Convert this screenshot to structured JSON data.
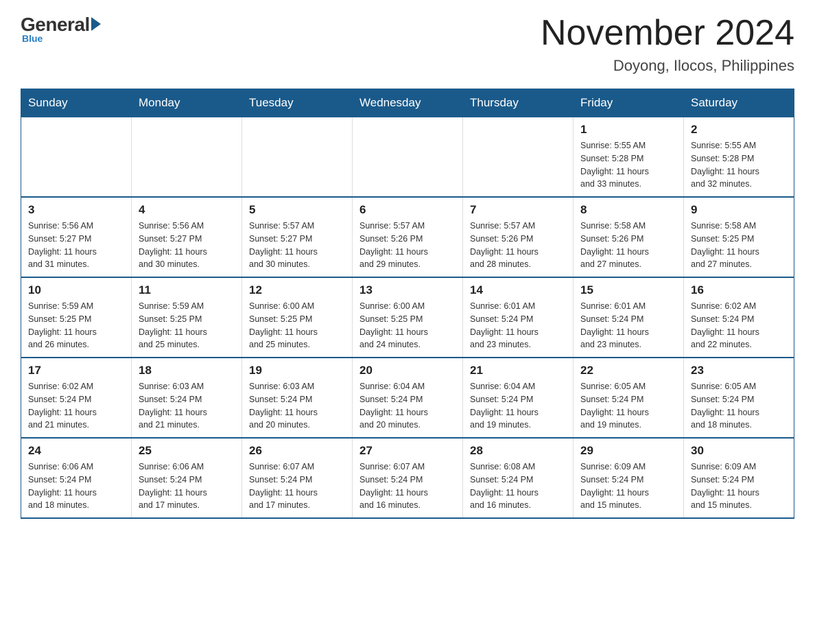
{
  "logo": {
    "general": "General",
    "blue": "Blue"
  },
  "header": {
    "title": "November 2024",
    "location": "Doyong, Ilocos, Philippines"
  },
  "weekdays": [
    "Sunday",
    "Monday",
    "Tuesday",
    "Wednesday",
    "Thursday",
    "Friday",
    "Saturday"
  ],
  "weeks": [
    [
      {
        "day": "",
        "info": ""
      },
      {
        "day": "",
        "info": ""
      },
      {
        "day": "",
        "info": ""
      },
      {
        "day": "",
        "info": ""
      },
      {
        "day": "",
        "info": ""
      },
      {
        "day": "1",
        "info": "Sunrise: 5:55 AM\nSunset: 5:28 PM\nDaylight: 11 hours\nand 33 minutes."
      },
      {
        "day": "2",
        "info": "Sunrise: 5:55 AM\nSunset: 5:28 PM\nDaylight: 11 hours\nand 32 minutes."
      }
    ],
    [
      {
        "day": "3",
        "info": "Sunrise: 5:56 AM\nSunset: 5:27 PM\nDaylight: 11 hours\nand 31 minutes."
      },
      {
        "day": "4",
        "info": "Sunrise: 5:56 AM\nSunset: 5:27 PM\nDaylight: 11 hours\nand 30 minutes."
      },
      {
        "day": "5",
        "info": "Sunrise: 5:57 AM\nSunset: 5:27 PM\nDaylight: 11 hours\nand 30 minutes."
      },
      {
        "day": "6",
        "info": "Sunrise: 5:57 AM\nSunset: 5:26 PM\nDaylight: 11 hours\nand 29 minutes."
      },
      {
        "day": "7",
        "info": "Sunrise: 5:57 AM\nSunset: 5:26 PM\nDaylight: 11 hours\nand 28 minutes."
      },
      {
        "day": "8",
        "info": "Sunrise: 5:58 AM\nSunset: 5:26 PM\nDaylight: 11 hours\nand 27 minutes."
      },
      {
        "day": "9",
        "info": "Sunrise: 5:58 AM\nSunset: 5:25 PM\nDaylight: 11 hours\nand 27 minutes."
      }
    ],
    [
      {
        "day": "10",
        "info": "Sunrise: 5:59 AM\nSunset: 5:25 PM\nDaylight: 11 hours\nand 26 minutes."
      },
      {
        "day": "11",
        "info": "Sunrise: 5:59 AM\nSunset: 5:25 PM\nDaylight: 11 hours\nand 25 minutes."
      },
      {
        "day": "12",
        "info": "Sunrise: 6:00 AM\nSunset: 5:25 PM\nDaylight: 11 hours\nand 25 minutes."
      },
      {
        "day": "13",
        "info": "Sunrise: 6:00 AM\nSunset: 5:25 PM\nDaylight: 11 hours\nand 24 minutes."
      },
      {
        "day": "14",
        "info": "Sunrise: 6:01 AM\nSunset: 5:24 PM\nDaylight: 11 hours\nand 23 minutes."
      },
      {
        "day": "15",
        "info": "Sunrise: 6:01 AM\nSunset: 5:24 PM\nDaylight: 11 hours\nand 23 minutes."
      },
      {
        "day": "16",
        "info": "Sunrise: 6:02 AM\nSunset: 5:24 PM\nDaylight: 11 hours\nand 22 minutes."
      }
    ],
    [
      {
        "day": "17",
        "info": "Sunrise: 6:02 AM\nSunset: 5:24 PM\nDaylight: 11 hours\nand 21 minutes."
      },
      {
        "day": "18",
        "info": "Sunrise: 6:03 AM\nSunset: 5:24 PM\nDaylight: 11 hours\nand 21 minutes."
      },
      {
        "day": "19",
        "info": "Sunrise: 6:03 AM\nSunset: 5:24 PM\nDaylight: 11 hours\nand 20 minutes."
      },
      {
        "day": "20",
        "info": "Sunrise: 6:04 AM\nSunset: 5:24 PM\nDaylight: 11 hours\nand 20 minutes."
      },
      {
        "day": "21",
        "info": "Sunrise: 6:04 AM\nSunset: 5:24 PM\nDaylight: 11 hours\nand 19 minutes."
      },
      {
        "day": "22",
        "info": "Sunrise: 6:05 AM\nSunset: 5:24 PM\nDaylight: 11 hours\nand 19 minutes."
      },
      {
        "day": "23",
        "info": "Sunrise: 6:05 AM\nSunset: 5:24 PM\nDaylight: 11 hours\nand 18 minutes."
      }
    ],
    [
      {
        "day": "24",
        "info": "Sunrise: 6:06 AM\nSunset: 5:24 PM\nDaylight: 11 hours\nand 18 minutes."
      },
      {
        "day": "25",
        "info": "Sunrise: 6:06 AM\nSunset: 5:24 PM\nDaylight: 11 hours\nand 17 minutes."
      },
      {
        "day": "26",
        "info": "Sunrise: 6:07 AM\nSunset: 5:24 PM\nDaylight: 11 hours\nand 17 minutes."
      },
      {
        "day": "27",
        "info": "Sunrise: 6:07 AM\nSunset: 5:24 PM\nDaylight: 11 hours\nand 16 minutes."
      },
      {
        "day": "28",
        "info": "Sunrise: 6:08 AM\nSunset: 5:24 PM\nDaylight: 11 hours\nand 16 minutes."
      },
      {
        "day": "29",
        "info": "Sunrise: 6:09 AM\nSunset: 5:24 PM\nDaylight: 11 hours\nand 15 minutes."
      },
      {
        "day": "30",
        "info": "Sunrise: 6:09 AM\nSunset: 5:24 PM\nDaylight: 11 hours\nand 15 minutes."
      }
    ]
  ]
}
